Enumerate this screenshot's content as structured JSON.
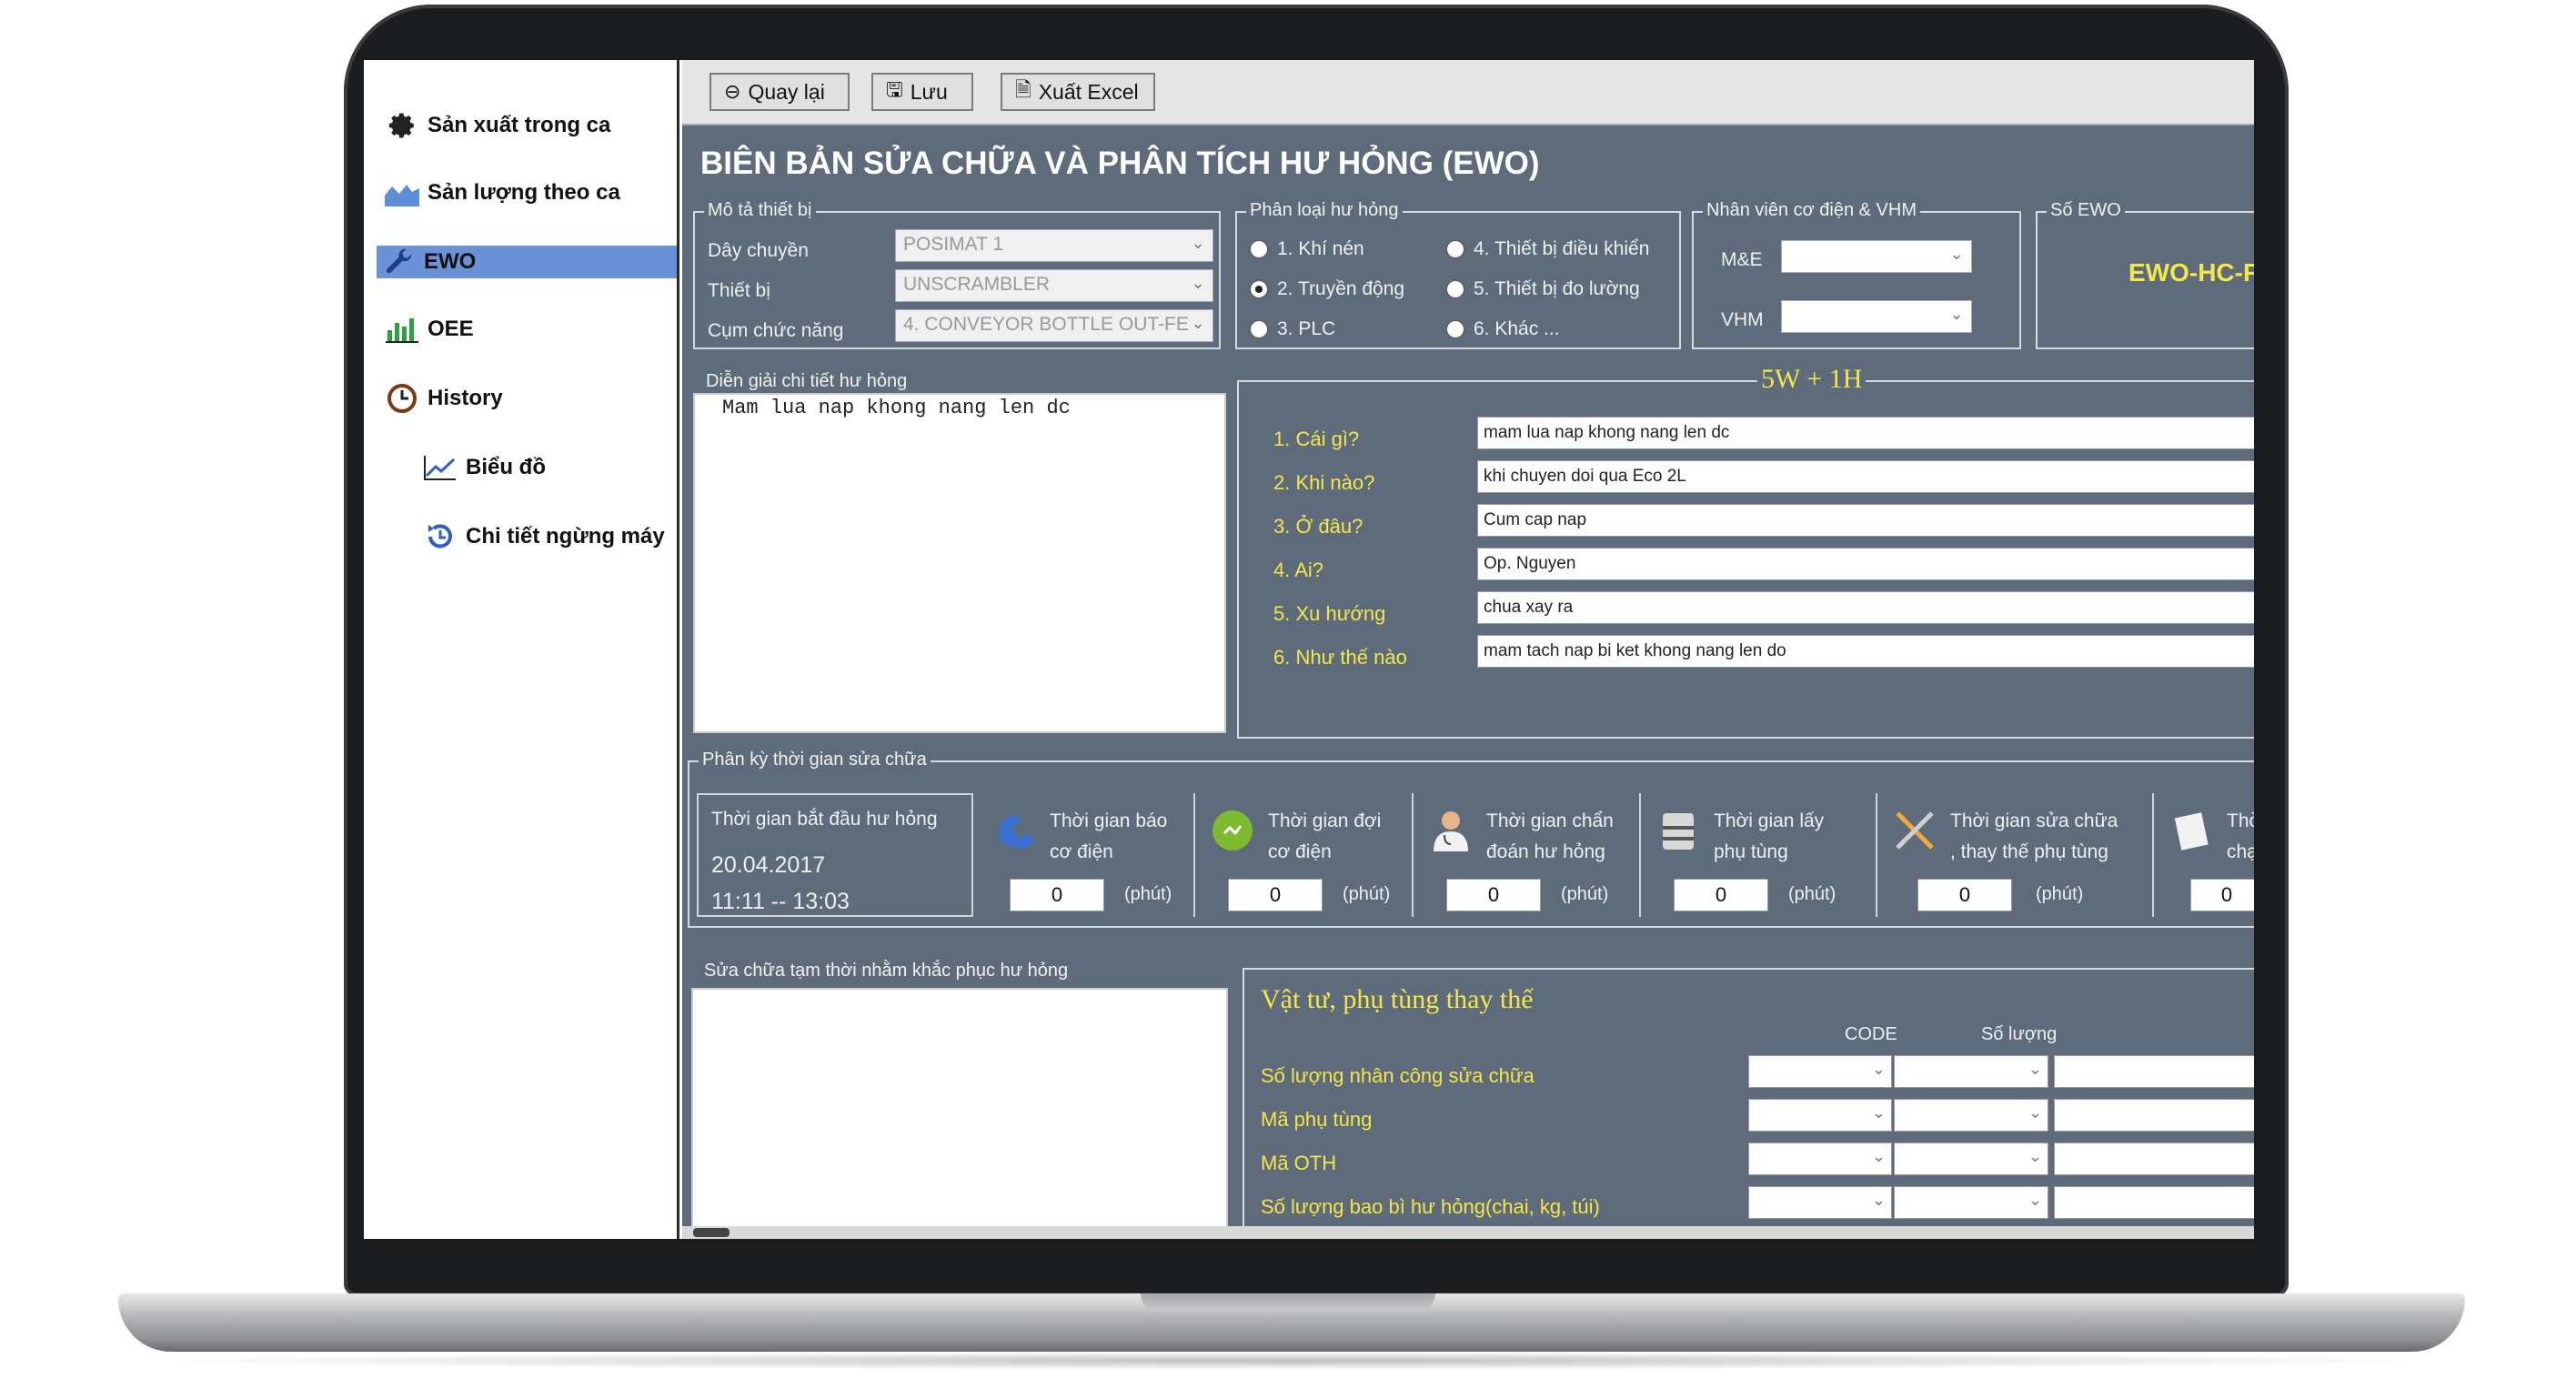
{
  "sidebar": {
    "items": [
      {
        "label": "Sản xuất trong ca",
        "icon": "gear-icon"
      },
      {
        "label": "Sản lượng theo ca",
        "icon": "area-chart-icon"
      },
      {
        "label": "EWO",
        "icon": "wrench-icon"
      },
      {
        "label": "OEE",
        "icon": "bar-chart-icon"
      },
      {
        "label": "History",
        "icon": "clock-icon"
      },
      {
        "label": "Biểu đồ",
        "icon": "line-chart-icon"
      },
      {
        "label": "Chi tiết ngừng máy",
        "icon": "history-icon"
      }
    ]
  },
  "toolbar": {
    "back_label": "Quay lại",
    "save_label": "Lưu",
    "export_label": "Xuất Excel"
  },
  "page_title": "BIÊN BẢN SỬA CHỮA VÀ PHÂN TÍCH HƯ HỎNG (EWO)",
  "device": {
    "group_label": "Mô tả thiết bị",
    "line_label": "Dây chuyền",
    "line_value": "POSIMAT 1",
    "equipment_label": "Thiết bị",
    "equipment_value": "UNSCRAMBLER",
    "function_label": "Cụm chức năng",
    "function_value": "4. CONVEYOR BOTTLE OUT-FE"
  },
  "failure_type": {
    "group_label": "Phân loại hư hỏng",
    "options": [
      "1. Khí nén",
      "2. Truyền động",
      "3. PLC",
      "4. Thiết bị điều khiển",
      "5. Thiết bị đo lường",
      "6. Khác ..."
    ],
    "selected": "2. Truyền động"
  },
  "staff": {
    "group_label": "Nhân viên cơ điện & VHM",
    "me_label": "M&E",
    "vhm_label": "VHM"
  },
  "ewo_no": {
    "group_label": "Số EWO",
    "value": "EWO-HC-F"
  },
  "detail": {
    "group_label": "Diễn giải chi tiết hư hỏng",
    "text": "Mam lua nap khong nang len dc"
  },
  "five_w": {
    "title": "5W + 1H",
    "questions": [
      {
        "label": "1. Cái gì?",
        "answer": "mam lua nap khong nang len dc"
      },
      {
        "label": "2. Khi nào?",
        "answer": "khi chuyen doi qua Eco 2L"
      },
      {
        "label": "3. Ở đâu?",
        "answer": "Cum cap nap"
      },
      {
        "label": "4. Ai?",
        "answer": "Op. Nguyen"
      },
      {
        "label": "5. Xu hướng",
        "answer": "chua xay ra"
      },
      {
        "label": "6. Như thế nào",
        "answer": "mam tach nap bi ket khong nang len do"
      }
    ]
  },
  "timing": {
    "group_label": "Phân kỳ thời gian sửa chữa",
    "start_label": "Thời gian bắt đầu hư hỏng",
    "start_date": "20.04.2017",
    "start_time": "11:11 -- 13:03",
    "unit": "(phút)",
    "segments": [
      {
        "line1": "Thời gian báo",
        "line2": "cơ điện",
        "value": "0",
        "icon": "phone-icon"
      },
      {
        "line1": "Thời gian đợi",
        "line2": "cơ điện",
        "value": "0",
        "icon": "wait-icon"
      },
      {
        "line1": "Thời gian chẩn",
        "line2": "đoán hư hỏng",
        "value": "0",
        "icon": "doctor-icon"
      },
      {
        "line1": "Thời gian lấy",
        "line2": "phụ tùng",
        "value": "0",
        "icon": "server-icon"
      },
      {
        "line1": "Thời gian sửa chữa",
        "line2": ", thay thế phụ tùng",
        "value": "0",
        "icon": "tools-icon"
      },
      {
        "line1": "Thờ",
        "line2": "chạ",
        "value": "0",
        "icon": "test-icon"
      }
    ]
  },
  "temp_fix": {
    "group_label": "Sửa chữa tạm thời nhằm khắc phục hư hỏng"
  },
  "materials": {
    "title": "Vật tư, phụ tùng thay thế",
    "col_code": "CODE",
    "col_qty": "Số lượng",
    "rows": [
      "Số lượng nhân công sửa chữa",
      "Mã phụ tùng",
      "Mã OTH",
      "Số lượng bao bì hư hỏng(chai, kg, túi)"
    ]
  }
}
